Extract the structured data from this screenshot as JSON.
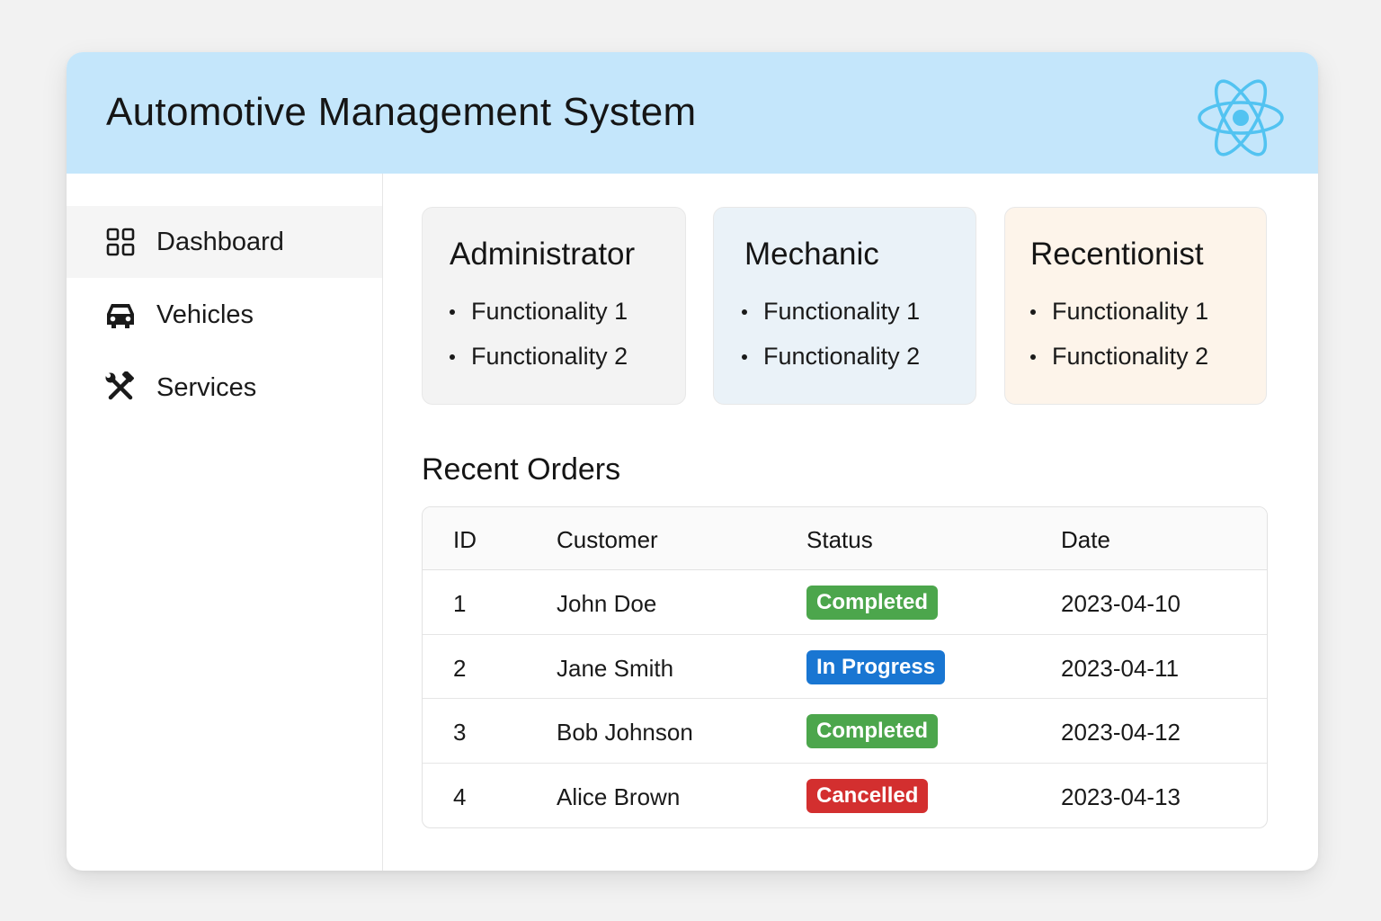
{
  "app": {
    "title": "Automotive Management System",
    "logo_icon": "react-atom-icon"
  },
  "sidebar": {
    "items": [
      {
        "label": "Dashboard",
        "icon": "grid-icon",
        "active": true
      },
      {
        "label": "Vehicles",
        "icon": "car-icon",
        "active": false
      },
      {
        "label": "Services",
        "icon": "tools-icon",
        "active": false
      }
    ]
  },
  "roles": [
    {
      "title": "Administrator",
      "bg": "#f3f3f3",
      "items": [
        "Functionality 1",
        "Functionality 2"
      ]
    },
    {
      "title": "Mechanic",
      "bg": "#eaf2f8",
      "items": [
        "Functionality 1",
        "Functionality 2"
      ]
    },
    {
      "title": "Recentionist",
      "bg": "#fdf4ea",
      "items": [
        "Functionality 1",
        "Functionality 2"
      ]
    }
  ],
  "orders": {
    "title": "Recent Orders",
    "columns": [
      "ID",
      "Customer",
      "Status",
      "Date"
    ],
    "rows": [
      {
        "id": "1",
        "customer": "John Doe",
        "status": "Completed",
        "status_color": "#4ca64c",
        "date": "2023-04-10"
      },
      {
        "id": "2",
        "customer": "Jane Smith",
        "status": "In Progress",
        "status_color": "#1976d2",
        "date": "2023-04-11"
      },
      {
        "id": "3",
        "customer": "Bob Johnson",
        "status": "Completed",
        "status_color": "#4ca64c",
        "date": "2023-04-12"
      },
      {
        "id": "4",
        "customer": "Alice Brown",
        "status": "Cancelled",
        "status_color": "#d32f2f",
        "date": "2023-04-13"
      }
    ]
  },
  "colors": {
    "header_bg": "#c4e6fb",
    "react_logo": "#52c3f1"
  }
}
